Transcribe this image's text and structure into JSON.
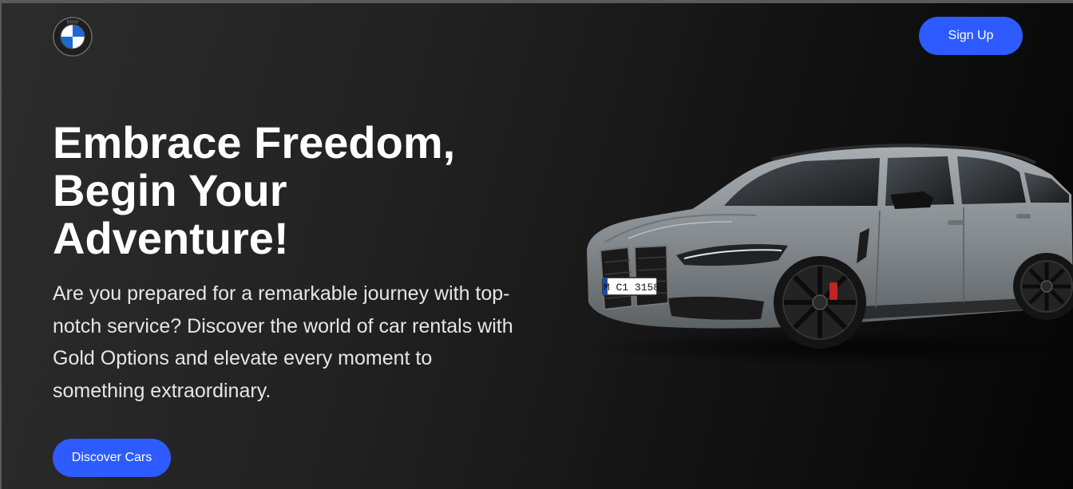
{
  "header": {
    "logo_icon": "bmw-roundel-logo",
    "logo_text": "BMW",
    "signup_label": "Sign Up"
  },
  "hero": {
    "headline_lines": [
      "Embrace Freedom,",
      "Begin Your",
      "Adventure!"
    ],
    "description": "Are you prepared for a remarkable journey with top-notch service? Discover the world of car rentals with Gold Options and elevate every moment to something extraordinary.",
    "cta_label": "Discover Cars",
    "car_image": "gray-bmw-m3-touring",
    "license_plate": "M C1 3158"
  },
  "colors": {
    "accent": "#2e5bff",
    "background_dark": "#1c1c1c",
    "text": "#ffffff"
  }
}
